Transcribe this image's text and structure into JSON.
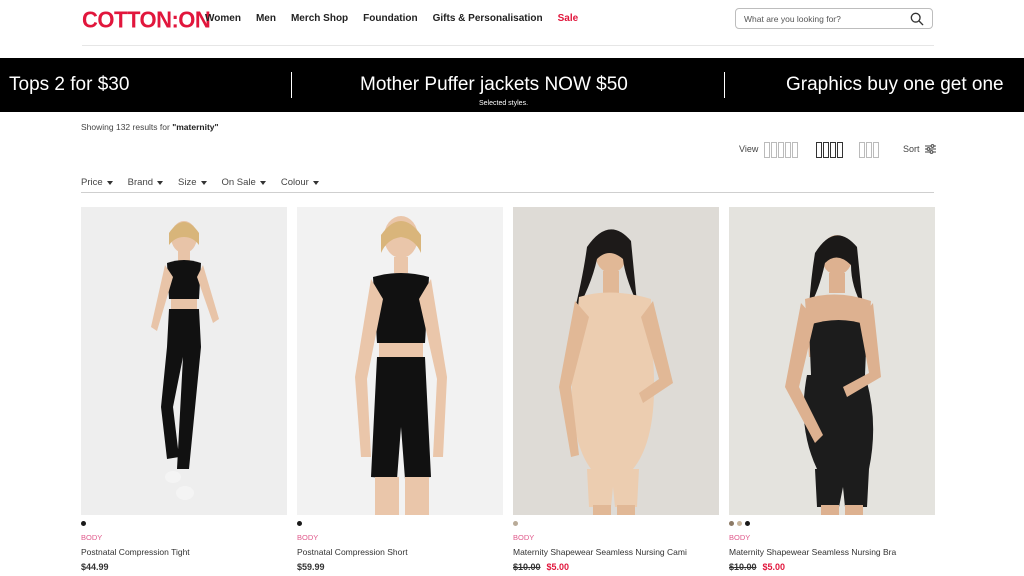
{
  "header": {
    "logo": "COTTON:ON",
    "nav": [
      "Women",
      "Men",
      "Merch Shop",
      "Foundation",
      "Gifts & Personalisation",
      "Sale"
    ],
    "search_placeholder": "What are you looking for?"
  },
  "promo": {
    "items": [
      "Tops 2 for $30",
      "Mother Puffer jackets NOW $50",
      "Graphics buy one get one"
    ],
    "subtext": "Selected styles."
  },
  "results": {
    "prefix": "Showing 132 results for ",
    "query": "\"maternity\""
  },
  "toolbar": {
    "view_label": "View",
    "sort_label": "Sort"
  },
  "filters": [
    "Price",
    "Brand",
    "Size",
    "On Sale",
    "Colour"
  ],
  "products": [
    {
      "brand": "BODY",
      "name": "Postnatal Compression Tight",
      "price": "$44.99",
      "was": "",
      "now": "",
      "swatches": [
        "#1a1a1a"
      ],
      "bg": "#eeeeee",
      "garment": "#111111",
      "skin": "#e8c4a8"
    },
    {
      "brand": "BODY",
      "name": "Postnatal Compression Short",
      "price": "$59.99",
      "was": "",
      "now": "",
      "swatches": [
        "#1a1a1a"
      ],
      "bg": "#f2f2f2",
      "garment": "#111111",
      "skin": "#eac6aa"
    },
    {
      "brand": "BODY",
      "name": "Maternity Shapewear Seamless Nursing Cami",
      "price": "",
      "was": "$10.00",
      "now": "$5.00",
      "swatches": [
        "#b9ab98"
      ],
      "bg": "#dedbd6",
      "garment": "#eccdb0",
      "skin": "#e1b896"
    },
    {
      "brand": "BODY",
      "name": "Maternity Shapewear Seamless Nursing Bra",
      "price": "",
      "was": "$10.00",
      "now": "$5.00",
      "swatches": [
        "#8c7a66",
        "#c8b59c",
        "#1a1a1a"
      ],
      "bg": "#e4e3de",
      "garment": "#1c1c1c",
      "skin": "#ddb190"
    }
  ]
}
